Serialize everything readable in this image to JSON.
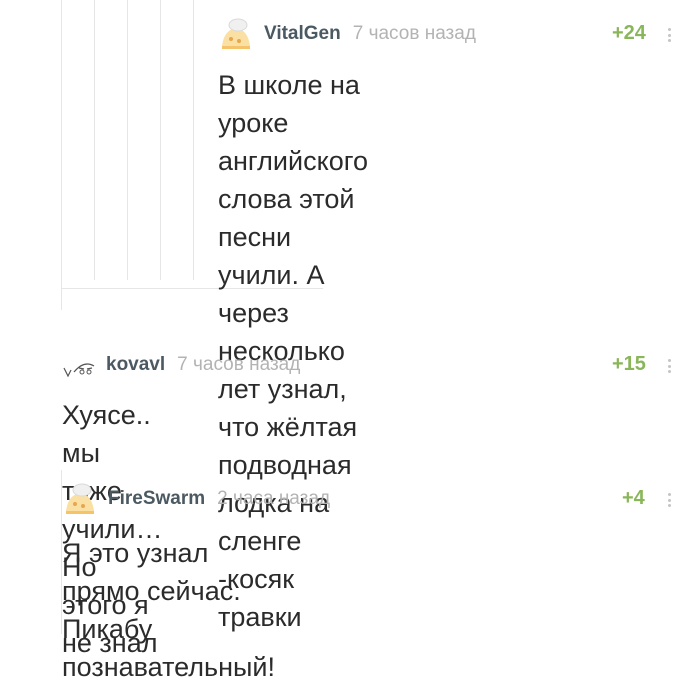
{
  "comments": [
    {
      "author": "VitalGen",
      "time": "7 часов назад",
      "rating": "+24",
      "text": "В школе на уроке английского\nслова этой песни учили. А через\nнесколько лет узнал, что жёлтая\nподводная лодка на сленге\n-косяк травки",
      "avatar_icon": "default-avatar-icon"
    },
    {
      "author": "kovavl",
      "time": "7 часов назад",
      "rating": "+15",
      "text": "Хуясе.. мы тоже учили… Но этого я не знал",
      "avatar_icon": "sketch-avatar-icon"
    },
    {
      "author": "FireSwarm",
      "time": "2 часа назад",
      "rating": "+4",
      "text": "Я это узнал прямо сейчас. Пикабу\nпознавательный!",
      "avatar_icon": "default-avatar-icon"
    }
  ],
  "colors": {
    "author": "#4b5a62",
    "time": "#b3b3b3",
    "rating": "#8ab65a",
    "text": "#2b2b2b",
    "thread_line": "#e6e6e6"
  }
}
